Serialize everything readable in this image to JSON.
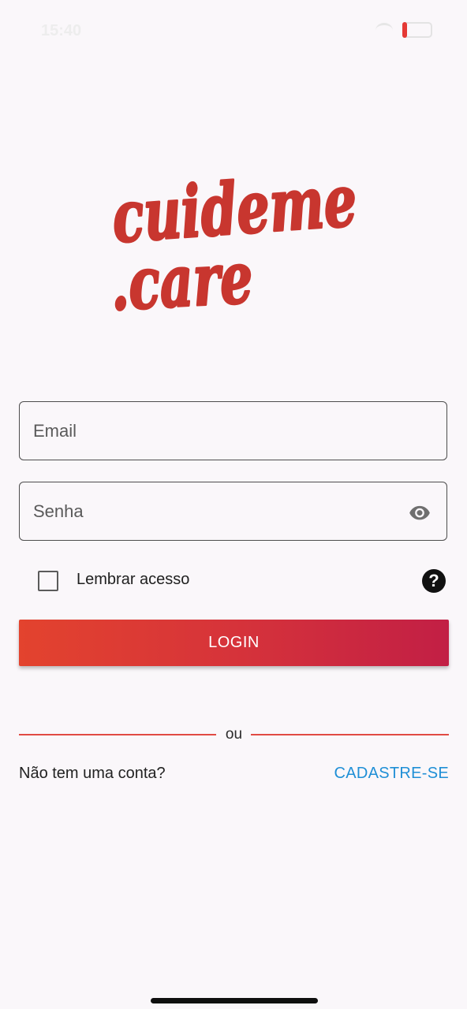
{
  "status_bar": {
    "time": "15:40"
  },
  "logo": {
    "line1": "cuideme",
    "line2": ".care",
    "color": "#c8362f"
  },
  "form": {
    "email_placeholder": "Email",
    "email_value": "",
    "password_placeholder": "Senha",
    "password_value": "",
    "remember_label": "Lembrar acesso",
    "remember_checked": false,
    "help_glyph": "?",
    "login_label": "LOGIN"
  },
  "divider": {
    "text": "ou"
  },
  "signup": {
    "question": "Não tem uma conta?",
    "link_label": "CADASTRE-SE"
  },
  "icons": {
    "password_toggle": "eye-icon",
    "help": "question-circle-icon"
  },
  "colors": {
    "accent_red": "#d6333a",
    "link_blue": "#1f8fd6",
    "background": "#faf7fa"
  }
}
